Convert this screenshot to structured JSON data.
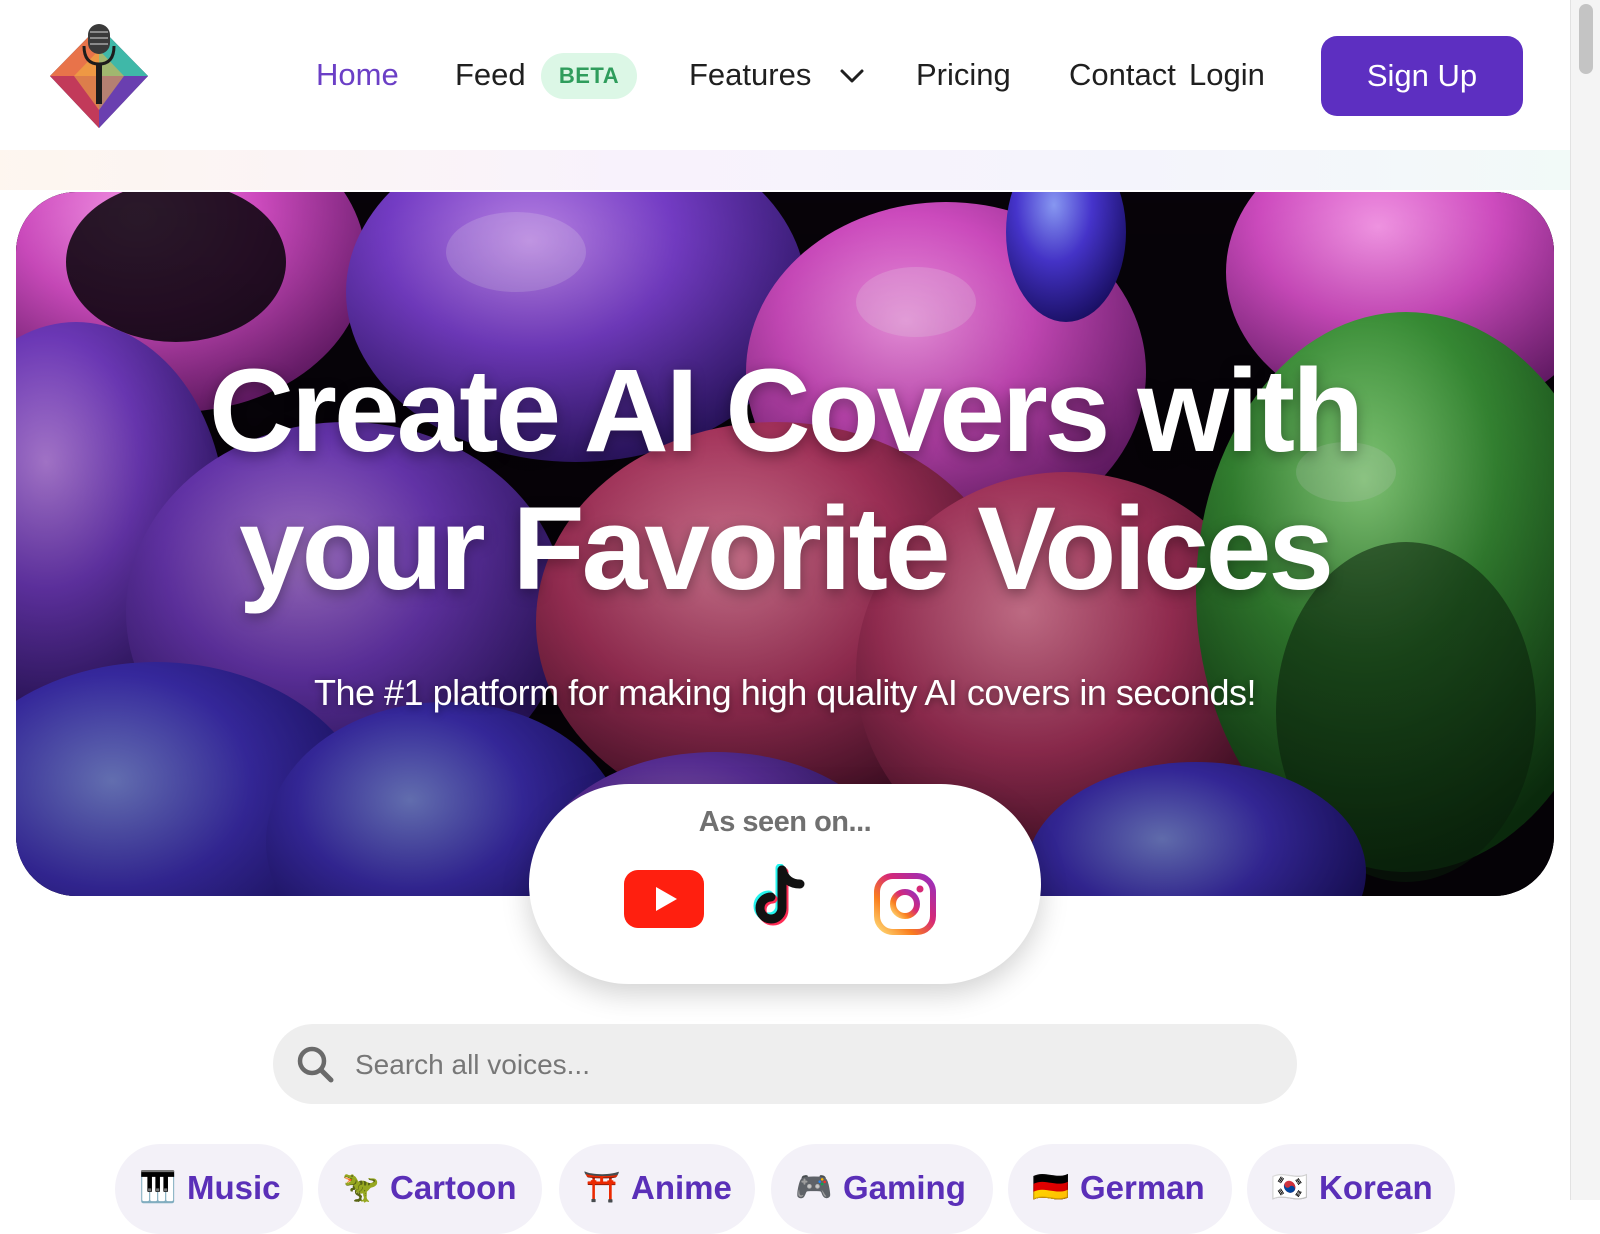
{
  "header": {
    "nav": {
      "home": "Home",
      "feed": "Feed",
      "feed_badge": "BETA",
      "features": "Features",
      "pricing": "Pricing",
      "contact": "Contact",
      "login": "Login"
    },
    "signup_label": "Sign Up"
  },
  "hero": {
    "title_line1": "Create AI Covers with",
    "title_line2": "your Favorite Voices",
    "subtitle": "The #1 platform for making high quality AI covers in seconds!"
  },
  "seen_on": {
    "title": "As seen on...",
    "platforms": [
      "youtube-icon",
      "tiktok-icon",
      "instagram-icon"
    ]
  },
  "search": {
    "placeholder": "Search all voices..."
  },
  "categories": [
    {
      "emoji": "🎹",
      "label": "Music"
    },
    {
      "emoji": "🦖",
      "label": "Cartoon"
    },
    {
      "emoji": "⛩️",
      "label": "Anime"
    },
    {
      "emoji": "🎮",
      "label": "Gaming"
    },
    {
      "emoji": "🇩🇪",
      "label": "German"
    },
    {
      "emoji": "🇰🇷",
      "label": "Korean"
    }
  ],
  "colors": {
    "brand": "#5d2fc1",
    "active_nav": "#6b3fc6",
    "beta_bg": "#dcf7e6",
    "beta_text": "#2f9d5c",
    "chip_text": "#5a2fb8"
  }
}
